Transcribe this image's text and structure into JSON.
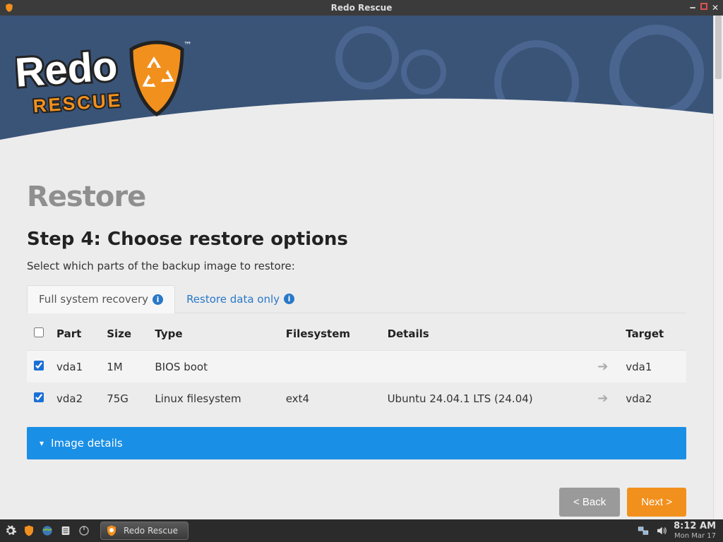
{
  "window": {
    "title": "Redo Rescue"
  },
  "logo": {
    "top_text": "Redo",
    "bottom_text": "RESCUE"
  },
  "page": {
    "title": "Restore",
    "step_title": "Step 4: Choose restore options",
    "instruction": "Select which parts of the backup image to restore:"
  },
  "tabs": {
    "full": "Full system recovery",
    "data_only": "Restore data only"
  },
  "table": {
    "headers": {
      "part": "Part",
      "size": "Size",
      "type": "Type",
      "filesystem": "Filesystem",
      "details": "Details",
      "target": "Target"
    },
    "rows": [
      {
        "checked": true,
        "part": "vda1",
        "size": "1M",
        "type": "BIOS boot",
        "filesystem": "",
        "details": "",
        "target": "vda1"
      },
      {
        "checked": true,
        "part": "vda2",
        "size": "75G",
        "type": "Linux filesystem",
        "filesystem": "ext4",
        "details": "Ubuntu 24.04.1 LTS (24.04)",
        "target": "vda2"
      }
    ]
  },
  "details_bar": {
    "label": "Image details"
  },
  "buttons": {
    "back": "< Back",
    "next": "Next >"
  },
  "taskbar": {
    "app_label": "Redo Rescue",
    "time": "8:12 AM",
    "date": "Mon Mar 17"
  }
}
